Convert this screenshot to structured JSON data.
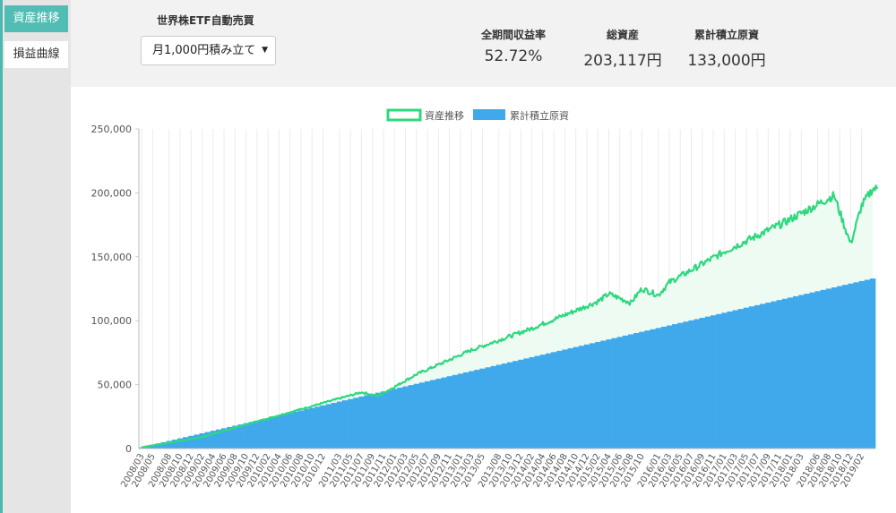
{
  "sidebar": {
    "tabs": [
      {
        "label": "資産推移",
        "active": true
      },
      {
        "label": "損益曲線",
        "active": false
      }
    ]
  },
  "header": {
    "etf_title": "世界株ETF自動売買",
    "plan_select": {
      "value": "月1,000円積み立て"
    },
    "stats": [
      {
        "label": "全期間収益率",
        "value": "52.72%"
      },
      {
        "label": "総資産",
        "value": "203,117円"
      },
      {
        "label": "累計積立原資",
        "value": "133,000円"
      }
    ]
  },
  "colors": {
    "asset_line": "#2ed87e",
    "principal_fill": "#40a9ec",
    "accent": "#52bdb5"
  },
  "chart_data": {
    "type": "area",
    "legend": [
      {
        "name": "資産推移",
        "style": "line",
        "color": "#2ed87e"
      },
      {
        "name": "累計積立原資",
        "style": "fill",
        "color": "#40a9ec"
      }
    ],
    "ylim": [
      0,
      250000
    ],
    "yticks": [
      "0",
      "50,000",
      "100,000",
      "150,000",
      "200,000",
      "250,000"
    ],
    "ytick_values": [
      0,
      50000,
      100000,
      150000,
      200000,
      250000
    ],
    "x_start": "2008/03",
    "x_end": "2019/04",
    "xtick_labels": [
      "2008/03",
      "2008/05",
      "2008/08",
      "2008/10",
      "2008/12",
      "2009/02",
      "2009/04",
      "2009/06",
      "2009/08",
      "2009/10",
      "2009/12",
      "2010/02",
      "2010/04",
      "2010/06",
      "2010/08",
      "2010/10",
      "2010/12",
      "2011/03",
      "2011/05",
      "2011/07",
      "2011/09",
      "2011/11",
      "2012/01",
      "2012/03",
      "2012/05",
      "2012/07",
      "2012/09",
      "2012/11",
      "2013/01",
      "2013/03",
      "2013/05",
      "2013/08",
      "2013/10",
      "2013/12",
      "2014/02",
      "2014/04",
      "2014/06",
      "2014/08",
      "2014/10",
      "2014/12",
      "2015/02",
      "2015/04",
      "2015/06",
      "2015/08",
      "2015/10",
      "2016/01",
      "2016/03",
      "2016/05",
      "2016/07",
      "2016/09",
      "2016/11",
      "2017/01",
      "2017/03",
      "2017/05",
      "2017/07",
      "2017/09",
      "2017/11",
      "2018/01",
      "2018/03",
      "2018/06",
      "2018/08",
      "2018/10",
      "2018/12",
      "2019/02"
    ],
    "principal": {
      "start": 1000,
      "end": 133000
    },
    "asset_keypoints": [
      {
        "x": "2008/03",
        "y": 1000
      },
      {
        "x": "2009/02",
        "y": 9000
      },
      {
        "x": "2010/04",
        "y": 26000
      },
      {
        "x": "2011/07",
        "y": 44000
      },
      {
        "x": "2011/10",
        "y": 41000
      },
      {
        "x": "2012/05",
        "y": 58000
      },
      {
        "x": "2013/03",
        "y": 77000
      },
      {
        "x": "2014/02",
        "y": 94000
      },
      {
        "x": "2015/02",
        "y": 115000
      },
      {
        "x": "2015/04",
        "y": 121000
      },
      {
        "x": "2015/08",
        "y": 114000
      },
      {
        "x": "2015/10",
        "y": 125000
      },
      {
        "x": "2016/01",
        "y": 120000
      },
      {
        "x": "2016/03",
        "y": 130000
      },
      {
        "x": "2017/01",
        "y": 154000
      },
      {
        "x": "2017/12",
        "y": 177000
      },
      {
        "x": "2018/09",
        "y": 198000
      },
      {
        "x": "2018/10",
        "y": 185000
      },
      {
        "x": "2018/12",
        "y": 160000
      },
      {
        "x": "2019/02",
        "y": 190000
      },
      {
        "x": "2019/04",
        "y": 203117
      }
    ]
  }
}
